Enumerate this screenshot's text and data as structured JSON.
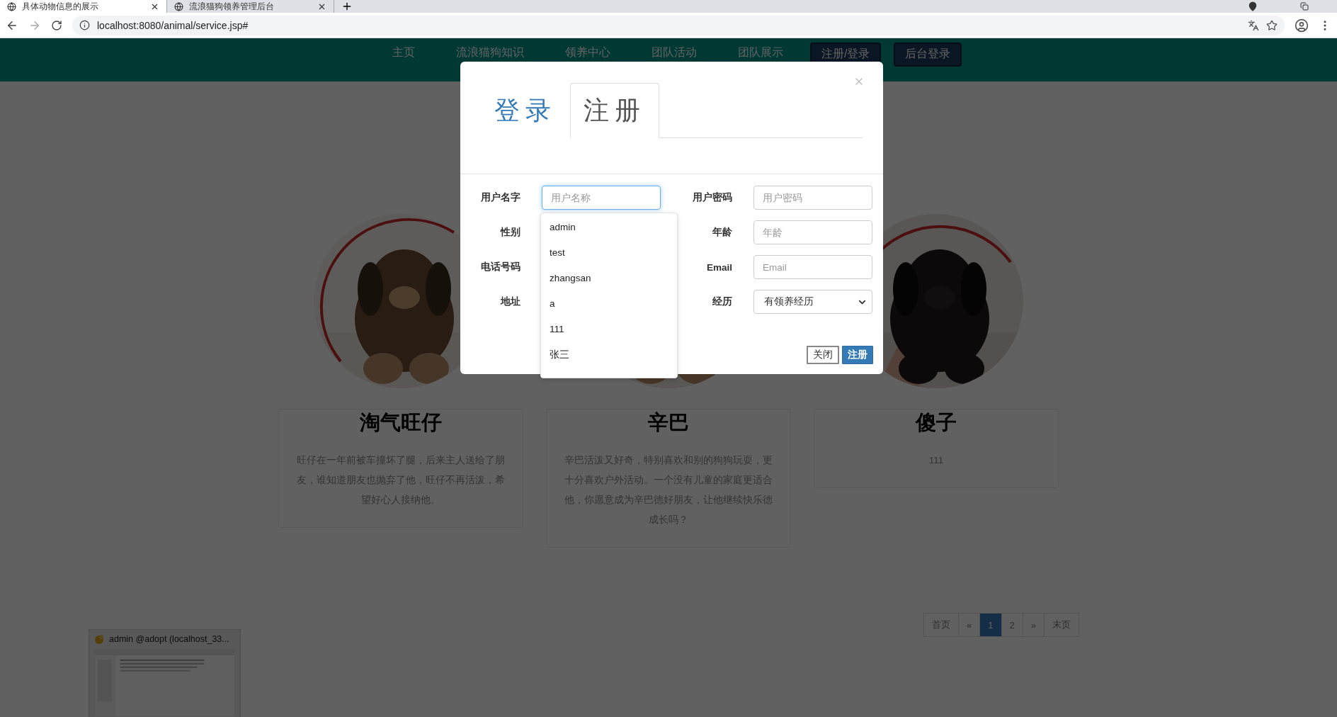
{
  "browser": {
    "tabs": [
      {
        "title": "具体动物信息的展示",
        "selected": true
      },
      {
        "title": "流浪猫狗领养管理后台",
        "selected": false
      }
    ],
    "url": "localhost:8080/animal/service.jsp#"
  },
  "navbar": {
    "links": [
      "主页",
      "流浪猫狗知识",
      "领养中心",
      "团队活动",
      "团队展示"
    ],
    "buttons": [
      "注册/登录",
      "后台登录"
    ]
  },
  "cards": [
    {
      "name": "淘气旺仔",
      "description": "旺仔在一年前被车撞坏了腿，后来主人送给了朋友，谁知道朋友也抛弃了他，旺仔不再活泼，希望好心人接纳他。"
    },
    {
      "name": "辛巴",
      "description": "辛巴活泼又好奇，特别喜欢和别的狗狗玩耍，更十分喜欢户外活动。一个没有儿童的家庭更适合他，你愿意成为辛巴德好朋友，让他继续快乐德成长吗？"
    },
    {
      "name": "傻子",
      "description": "111"
    }
  ],
  "pagination": [
    {
      "label": "首页",
      "selected": false
    },
    {
      "label": "«",
      "selected": false
    },
    {
      "label": "1",
      "selected": true
    },
    {
      "label": "2",
      "selected": false
    },
    {
      "label": "»",
      "selected": false
    },
    {
      "label": "末页",
      "selected": false
    }
  ],
  "taskbar_preview": {
    "title": "admin @adopt (localhost_33..."
  },
  "modal": {
    "tabs": [
      {
        "label": "登录",
        "selected": false
      },
      {
        "label": "注册",
        "selected": true
      }
    ],
    "fields": [
      {
        "label": "用户名字",
        "kind": "input",
        "placeholder": "用户名称",
        "focused": true
      },
      {
        "label": "用户密码",
        "kind": "input",
        "placeholder": "用户密码",
        "focused": false
      },
      {
        "label": "性别",
        "kind": "covered"
      },
      {
        "label": "年龄",
        "kind": "input",
        "placeholder": "年龄",
        "focused": false
      },
      {
        "label": "电话号码",
        "kind": "covered"
      },
      {
        "label": "Email",
        "kind": "input",
        "placeholder": "Email",
        "focused": false
      },
      {
        "label": "地址",
        "kind": "covered"
      },
      {
        "label": "经历",
        "kind": "select",
        "value": "有领养经历"
      }
    ],
    "suggestions": [
      "admin",
      "test",
      "zhangsan",
      "a",
      "111",
      "张三"
    ],
    "buttons": [
      {
        "label": "关闭",
        "kind": "default"
      },
      {
        "label": "注册",
        "kind": "primary"
      }
    ]
  }
}
